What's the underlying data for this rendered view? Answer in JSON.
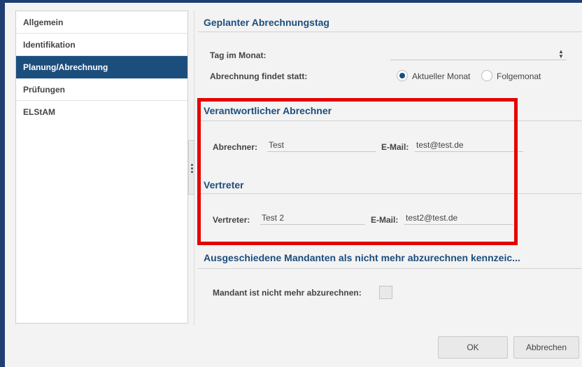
{
  "sidebar": {
    "items": [
      {
        "label": "Allgemein"
      },
      {
        "label": "Identifikation"
      },
      {
        "label": "Planung/Abrechnung"
      },
      {
        "label": "Prüfungen"
      },
      {
        "label": "ELStAM"
      }
    ]
  },
  "billing_day": {
    "title": "Geplanter Abrechnungstag",
    "day_label": "Tag im Monat:",
    "day_value": "",
    "billing_label": "Abrechnung findet statt:",
    "option_current": "Aktueller Monat",
    "option_next": "Folgemonat",
    "selected": "Aktueller Monat"
  },
  "responsible": {
    "title": "Verantwortlicher Abrechner",
    "name_label": "Abrechner:",
    "name_value": "Test",
    "email_label": "E-Mail:",
    "email_value": "test@test.de"
  },
  "deputy": {
    "title": "Vertreter",
    "name_label": "Vertreter:",
    "name_value": "Test 2",
    "email_label": "E-Mail:",
    "email_value": "test2@test.de"
  },
  "retired": {
    "title": "Ausgeschiedene Mandanten als nicht mehr abzurechnen kennzeic...",
    "checkbox_label": "Mandant ist nicht mehr abzurechnen:",
    "checked": false
  },
  "buttons": {
    "ok": "OK",
    "cancel": "Abbrechen"
  },
  "colors": {
    "accent": "#1c4e7d",
    "highlight_box": "#e50000"
  }
}
